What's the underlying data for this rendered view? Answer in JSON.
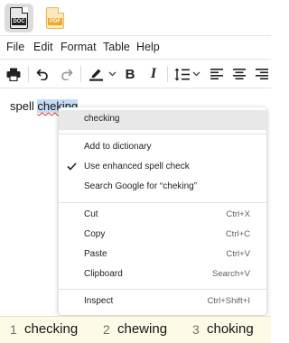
{
  "doc_tabs": {
    "active": {
      "file_type": "DOC",
      "icon": "doc-file-icon"
    },
    "inactive": {
      "file_type": "PDF",
      "icon": "pdf-file-icon"
    }
  },
  "menubar": {
    "items": [
      "File",
      "Edit",
      "Format",
      "Table",
      "Help"
    ]
  },
  "toolbar": {
    "icons": [
      "printer-icon",
      "undo-icon",
      "redo-icon",
      "text-highlight-icon",
      "chevron-down-icon",
      "bold-icon",
      "italic-icon",
      "line-spacing-icon",
      "chevron-down-icon",
      "align-left-icon",
      "align-center-icon",
      "align-right-icon"
    ],
    "bold_label": "B",
    "italic_label": "I"
  },
  "editor": {
    "text_before": "spell ",
    "misspelled_word": "cheking"
  },
  "context_menu": {
    "suggestion": "checking",
    "add_to_dictionary": "Add to dictionary",
    "enhanced_spell_check": {
      "label": "Use enhanced spell check",
      "checked": true
    },
    "search_google": "Search Google for “cheking”",
    "cut": {
      "label": "Cut",
      "shortcut": "Ctrl+X"
    },
    "copy": {
      "label": "Copy",
      "shortcut": "Ctrl+C"
    },
    "paste": {
      "label": "Paste",
      "shortcut": "Ctrl+V"
    },
    "clipboard": {
      "label": "Clipboard",
      "shortcut": "Search+V"
    },
    "inspect": {
      "label": "Inspect",
      "shortcut": "Ctrl+Shift+I"
    }
  },
  "candidates": [
    {
      "number": "1",
      "word": "checking"
    },
    {
      "number": "2",
      "word": "chewing"
    },
    {
      "number": "3",
      "word": "choking"
    }
  ],
  "colors": {
    "selection_highlight": "#c4dcf5",
    "spell_error_underline": "#d9302c",
    "candidate_bar_bg": "#fdfbe8",
    "pdf_icon": "#f2a825"
  }
}
